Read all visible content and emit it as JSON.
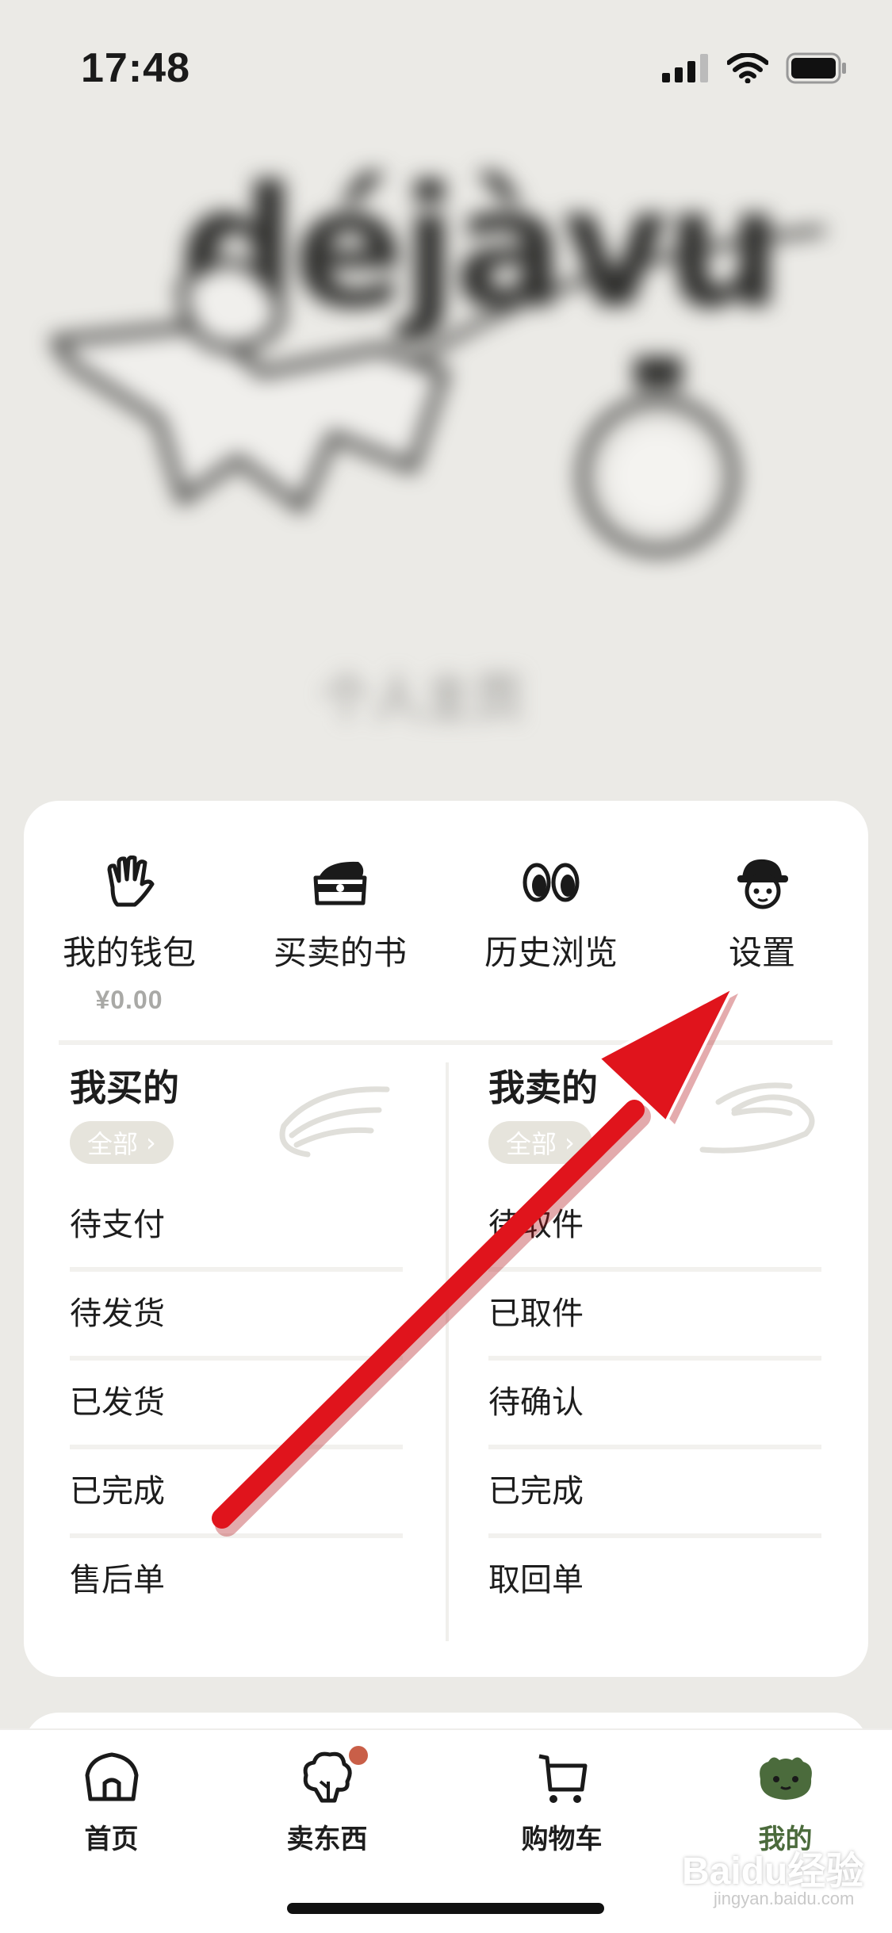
{
  "status_bar": {
    "time": "17:48"
  },
  "hero": {
    "brand": "déjàvu",
    "tagline": "个人主页"
  },
  "quick_actions": [
    {
      "label": "我的钱包",
      "sub": "¥0.00",
      "icon": "hand-icon"
    },
    {
      "label": "买卖的书",
      "sub": "",
      "icon": "book-box-icon"
    },
    {
      "label": "历史浏览",
      "sub": "",
      "icon": "eyes-icon"
    },
    {
      "label": "设置",
      "sub": "",
      "icon": "hat-face-icon"
    }
  ],
  "bought": {
    "title": "我买的",
    "all_label": "全部",
    "items": [
      "待支付",
      "待发货",
      "已发货",
      "已完成",
      "售后单"
    ]
  },
  "sold": {
    "title": "我卖的",
    "all_label": "全部",
    "items": [
      "待取件",
      "已取件",
      "待确认",
      "已完成",
      "取回单"
    ]
  },
  "tabs": [
    {
      "label": "首页",
      "icon": "house-icon"
    },
    {
      "label": "卖东西",
      "icon": "tree-icon",
      "badge": true
    },
    {
      "label": "购物车",
      "icon": "cart-icon"
    },
    {
      "label": "我的",
      "icon": "frog-face-icon",
      "active": true
    }
  ],
  "colors": {
    "active_tab": "#4b6b3c",
    "annotation_arrow": "#e0141c",
    "badge": "#c95f48"
  },
  "watermark": {
    "text": "Baidu经验",
    "sub": "jingyan.baidu.com"
  }
}
